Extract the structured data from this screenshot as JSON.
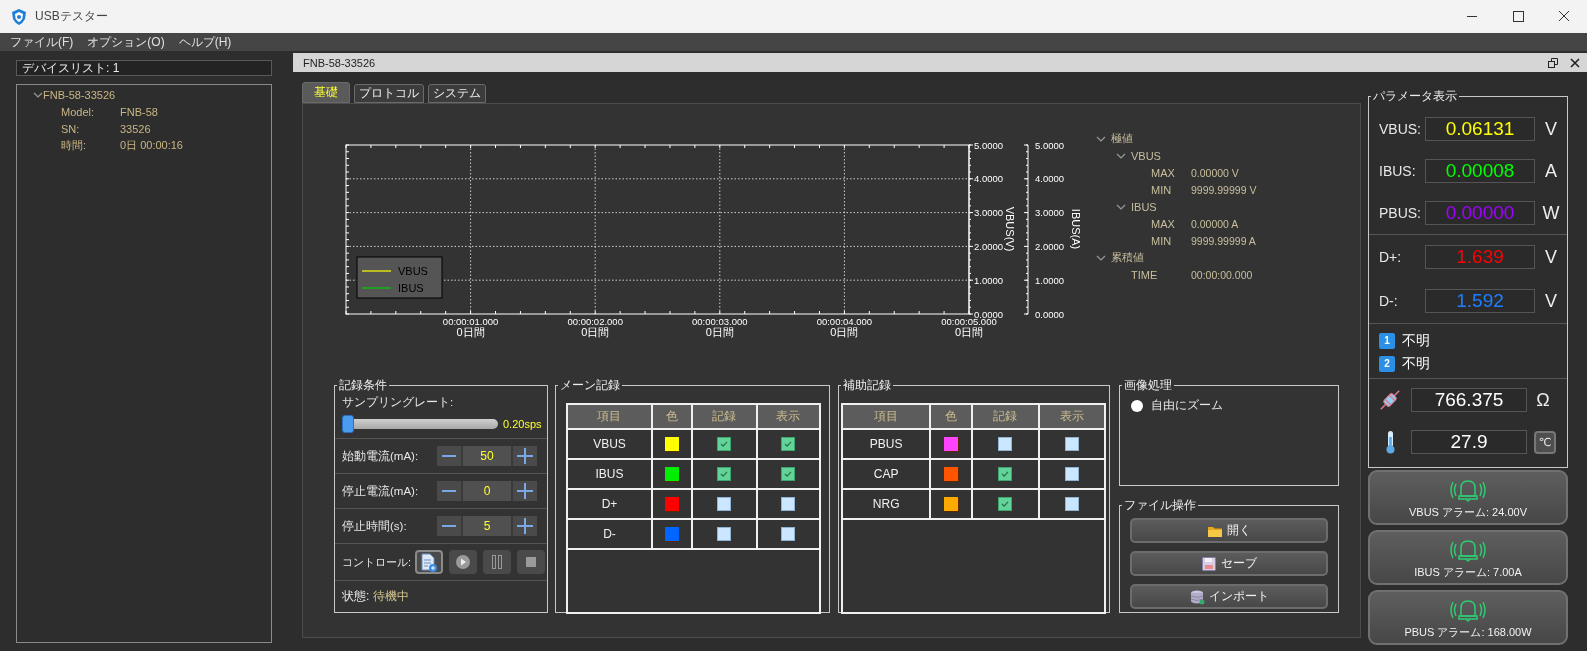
{
  "window": {
    "title": "USBテスター"
  },
  "menu": [
    "ファイル(F)",
    "オプション(O)",
    "ヘルプ(H)"
  ],
  "device_list": {
    "label": "デバイスリスト: 1",
    "tree": [
      {
        "label": "FNB-58-33526",
        "expanded": true,
        "children": [
          {
            "label": "Model:",
            "value": "FNB-58"
          },
          {
            "label": "SN:",
            "value": "33526"
          },
          {
            "label": "時間:",
            "value": "0日 00:00:16"
          }
        ]
      }
    ]
  },
  "document": {
    "title": "FNB-58-33526"
  },
  "tabs": [
    {
      "label": "基礎",
      "selected": true
    },
    {
      "label": "プロトコル",
      "selected": false
    },
    {
      "label": "システム",
      "selected": false
    }
  ],
  "chart": {
    "chart_data": {
      "type": "line",
      "ylabel": "VBUS(V)",
      "ylim": [
        0,
        5
      ],
      "grid": true,
      "categories": [
        "00:00:01.000\n0日間",
        "00:00:02.000\n0日間",
        "00:00:03.000\n0日間",
        "00:00:04.000\n0日間",
        "00:00:05.000\n0日間"
      ],
      "yticks": [
        {
          "value": 0,
          "label": "0.0000"
        },
        {
          "value": 1,
          "label": "1.0000"
        },
        {
          "value": 2,
          "label": "2.0000"
        },
        {
          "value": 3,
          "label": "3.0000"
        },
        {
          "value": 4,
          "label": "4.0000"
        },
        {
          "value": 5,
          "label": "5.0000"
        }
      ],
      "series": [
        {
          "name": "VBUS",
          "color": "#ffff00",
          "values": [
            null,
            null,
            null,
            null,
            null
          ]
        },
        {
          "name": "IBUS",
          "color": "#00d000",
          "values": [
            null,
            null,
            null,
            null,
            null
          ]
        }
      ]
    },
    "secondary_axis": {
      "label": "IBUS(A)",
      "ticks": [
        "5.0000",
        "4.0000",
        "3.0000",
        "2.0000",
        "1.0000",
        "0.0000"
      ]
    }
  },
  "extremes": [
    {
      "label": "極値",
      "expanded": true,
      "children": [
        {
          "label": "VBUS",
          "expanded": true,
          "children": [
            {
              "label": "MAX",
              "value": "0.00000 V"
            },
            {
              "label": "MIN",
              "value": "9999.99999 V"
            }
          ]
        },
        {
          "label": "IBUS",
          "expanded": true,
          "children": [
            {
              "label": "MAX",
              "value": "0.00000 A"
            },
            {
              "label": "MIN",
              "value": "9999.99999 A"
            }
          ]
        }
      ]
    },
    {
      "label": "累積値",
      "expanded": true,
      "children": [
        {
          "label": "TIME",
          "value": "00:00:00.000"
        }
      ]
    }
  ],
  "record_settings": {
    "title": "記録条件",
    "sampling": {
      "label": "サンプリングレート:",
      "level": 0,
      "reading": "0.20sps"
    },
    "spinners": [
      {
        "label": "始動電流(mA):",
        "value": "50"
      },
      {
        "label": "停止電流(mA):",
        "value": "0"
      },
      {
        "label": "停止時間(s):",
        "value": "5"
      }
    ],
    "controls": {
      "label": "コントロール:",
      "buttons": [
        {
          "kind": "new",
          "focused": true
        },
        {
          "kind": "play",
          "focused": false
        },
        {
          "kind": "pause",
          "focused": false
        },
        {
          "kind": "stop",
          "focused": false
        }
      ]
    },
    "status": {
      "label": "状態:",
      "value": "待機中"
    }
  },
  "main_record": {
    "title": "メーン記録",
    "columns": [
      "項目",
      "色",
      "記録",
      "表示"
    ],
    "rows": [
      {
        "name": "VBUS",
        "color": "#ffff00",
        "record": true,
        "display": true
      },
      {
        "name": "IBUS",
        "color": "#00ee00",
        "record": true,
        "display": true
      },
      {
        "name": "D+",
        "color": "#ff0000",
        "record": false,
        "display": false
      },
      {
        "name": "D-",
        "color": "#0066ff",
        "record": false,
        "display": false
      }
    ]
  },
  "aux_record": {
    "title": "補助記録",
    "columns": [
      "項目",
      "色",
      "記録",
      "表示"
    ],
    "rows": [
      {
        "name": "PBUS",
        "color": "#ff44ff",
        "record": false,
        "display": false
      },
      {
        "name": "CAP",
        "color": "#ff5500",
        "record": true,
        "display": false
      },
      {
        "name": "NRG",
        "color": "#ffaa00",
        "record": true,
        "display": false
      }
    ]
  },
  "image_processing": {
    "title": "画像処理",
    "zoom": {
      "label": "自由にズーム",
      "checked": false
    }
  },
  "file_operations": {
    "title": "ファイル操作",
    "buttons": [
      {
        "kind": "open",
        "label": "開く"
      },
      {
        "kind": "save",
        "label": "セーブ"
      },
      {
        "kind": "import",
        "label": "インポート"
      }
    ]
  },
  "parameters": {
    "title": "パラメータ表示",
    "bus_readings": [
      {
        "label": "VBUS:",
        "value": "0.06131",
        "unit": "V",
        "color": "#ffff00"
      },
      {
        "label": "IBUS:",
        "value": "0.00008",
        "unit": "A",
        "color": "#00ff00"
      },
      {
        "label": "PBUS:",
        "value": "0.00000",
        "unit": "W",
        "color": "#a000ff"
      }
    ],
    "data_line_readings": [
      {
        "label": "D+:",
        "value": "1.639",
        "unit": "V",
        "color": "#ff0000"
      },
      {
        "label": "D-:",
        "value": "1.592",
        "unit": "V",
        "color": "#1e7fff"
      }
    ],
    "ports": [
      {
        "badge": "1",
        "text": "不明"
      },
      {
        "badge": "2",
        "text": "不明"
      }
    ],
    "resistance": {
      "value": "766.375",
      "unit": "Ω"
    },
    "temperature": {
      "value": "27.9",
      "unit": "℃"
    }
  },
  "alarms": [
    "VBUS アラーム: 24.00V",
    "IBUS アラーム: 7.00A",
    "PBUS アラーム: 168.00W"
  ]
}
